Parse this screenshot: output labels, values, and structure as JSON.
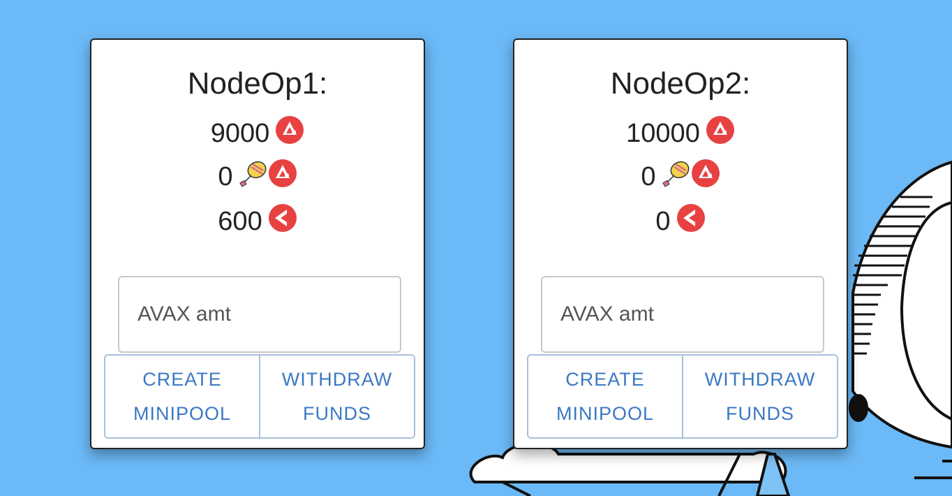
{
  "colors": {
    "background": "#6bb9f6",
    "avax_red": "#e84142",
    "button_text": "#3b78c4"
  },
  "icons": {
    "avax": "avalanche-logo-icon",
    "balloon": "hot-air-balloon-icon",
    "ggp": "gogopool-triangle-icon"
  },
  "cards": [
    {
      "title": "NodeOp1:",
      "avax_balance": "9000",
      "ggavax_balance": "0",
      "ggp_balance": "600",
      "input": {
        "placeholder": "AVAX amt",
        "value": ""
      },
      "buttons": {
        "create": [
          "CREATE",
          "MINIPOOL"
        ],
        "withdraw": [
          "WITHDRAW",
          "FUNDS"
        ]
      }
    },
    {
      "title": "NodeOp2:",
      "avax_balance": "10000",
      "ggavax_balance": "0",
      "ggp_balance": "0",
      "input": {
        "placeholder": "AVAX amt",
        "value": ""
      },
      "buttons": {
        "create": [
          "CREATE",
          "MINIPOOL"
        ],
        "withdraw": [
          "WITHDRAW",
          "FUNDS"
        ]
      }
    }
  ]
}
